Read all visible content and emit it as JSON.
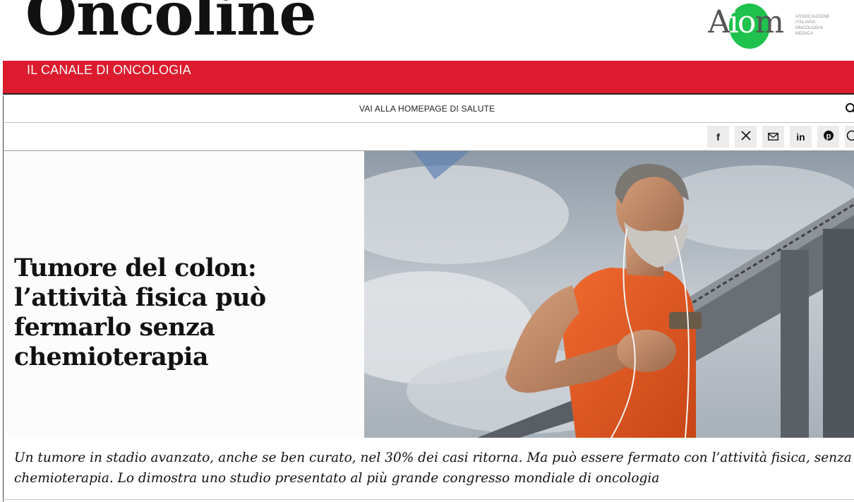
{
  "site": {
    "logo": "Oncoline",
    "partner_logo": "AIOM",
    "partner_logo_lead": "A",
    "partner_logo_io": "io",
    "partner_logo_tail": "m",
    "partner_subtitle": "ASSOCIAZIONE ITALIANA ONCOLOGIA MEDICA",
    "channel": "IL CANALE DI ONCOLOGIA",
    "brand_red": "#dc1b2e",
    "partner_green": "#1ec24c"
  },
  "nav": {
    "homepage_link": "VAI ALLA HOMEPAGE DI SALUTE",
    "search_icon": "search-icon"
  },
  "share": {
    "buttons": [
      {
        "name": "facebook",
        "glyph": "f"
      },
      {
        "name": "x",
        "glyph": "𝕏"
      },
      {
        "name": "email",
        "glyph": "✉"
      },
      {
        "name": "linkedin",
        "glyph": "in"
      },
      {
        "name": "pinterest",
        "glyph": "℗"
      },
      {
        "name": "whatsapp",
        "glyph": "✆"
      }
    ]
  },
  "article": {
    "headline": "Tumore del colon: l’attività fisica può fermarlo senza chemioterapia",
    "summary": "Un tumore in stadio avanzato, anche se ben curato, nel 30% dei casi ritorna. Ma può essere fermato con l’attività fisica, senza chemioterapia. Lo dimostra uno studio presentato al più grande congresso mondiale di oncologia"
  }
}
